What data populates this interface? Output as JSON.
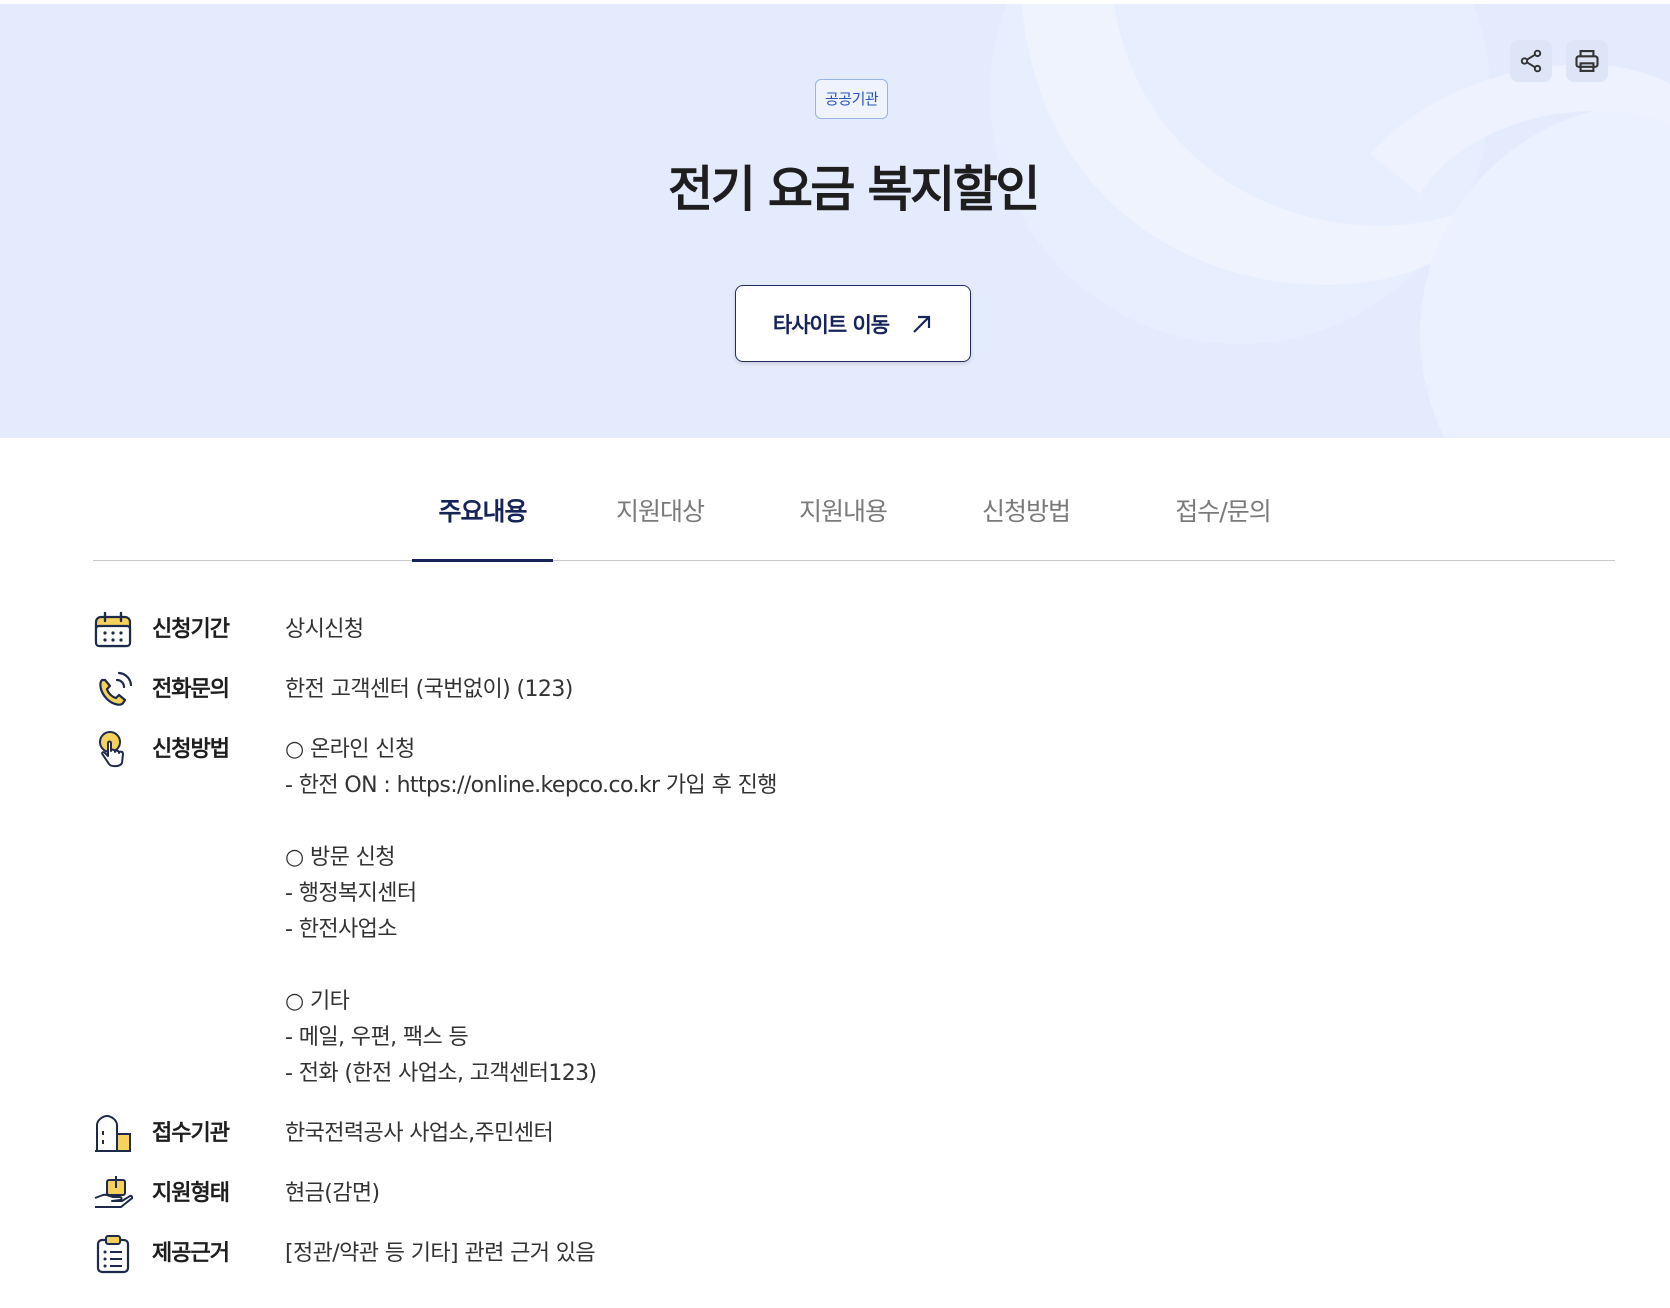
{
  "hero": {
    "badge": "공공기관",
    "title": "전기 요금 복지할인",
    "cta_label": "타사이트 이동",
    "share_icon": "share-icon",
    "print_icon": "print-icon",
    "accent": "#16245a",
    "background": "#e3ebfd"
  },
  "tabs": [
    {
      "label": "주요내용",
      "active": true
    },
    {
      "label": "지원대상",
      "active": false
    },
    {
      "label": "지원내용",
      "active": false
    },
    {
      "label": "신청방법",
      "active": false
    },
    {
      "label": "접수/문의",
      "active": false
    }
  ],
  "info": [
    {
      "icon": "calendar-icon",
      "label": "신청기간",
      "value": "상시신청"
    },
    {
      "icon": "phone-icon",
      "label": "전화문의",
      "value": "한전 고객센터 (국번없이) (123)"
    },
    {
      "icon": "hand-pointer-icon",
      "label": "신청방법",
      "value": "○ 온라인 신청\n- 한전 ON : https://online.kepco.co.kr 가입 후 진행\n\n○ 방문 신청\n- 행정복지센터\n- 한전사업소\n\n○ 기타\n- 메일, 우편, 팩스 등\n- 전화 (한전 사업소, 고객센터123)"
    },
    {
      "icon": "building-icon",
      "label": "접수기관",
      "value": "한국전력공사 사업소,주민센터"
    },
    {
      "icon": "support-hand-icon",
      "label": "지원형태",
      "value": "현금(감면)"
    },
    {
      "icon": "clipboard-icon",
      "label": "제공근거",
      "value": "[정관/약관 등 기타] 관련 근거 있음"
    }
  ]
}
